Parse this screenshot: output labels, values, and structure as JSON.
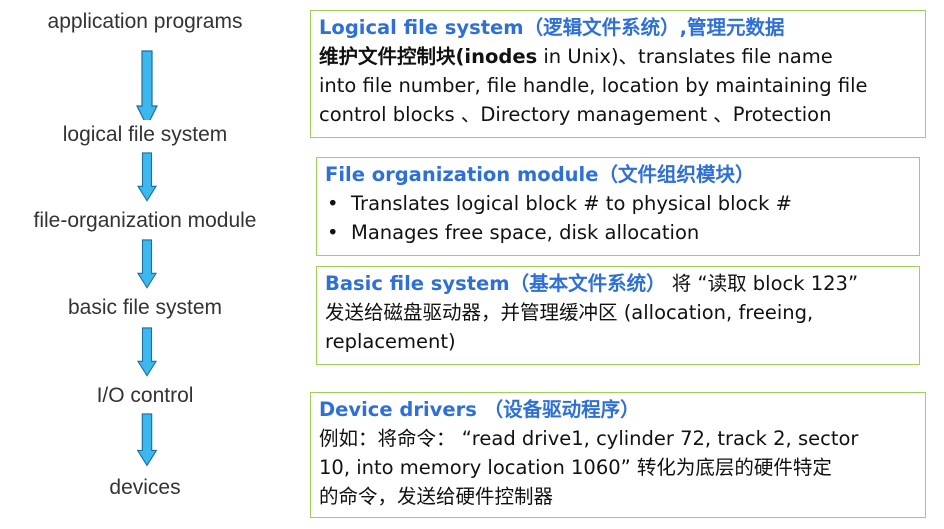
{
  "colors": {
    "accent": "#2e6fd8",
    "box_border": "#9fd15a",
    "arrow_fill": "#3db8ee",
    "arrow_stroke": "#1a6e9e"
  },
  "layers": [
    "application programs",
    "logical file system",
    "file-organization module",
    "basic file system",
    "I/O control",
    "devices"
  ],
  "boxes": {
    "logical": {
      "title": "Logical file system（逻辑文件系统）,管理元数据",
      "line1_pre": "维护文件控制块(",
      "line1_bold": "inodes",
      "line1_post": " in Unix)、translates file name",
      "line2": "into file number, file handle, location by maintaining file",
      "line3": "control blocks 、Directory management 、Protection"
    },
    "organization": {
      "title": "File organization module（文件组织模块）",
      "bullet_symbol": "•",
      "bullets": [
        "Translates logical block # to physical block #",
        "Manages free space, disk allocation"
      ]
    },
    "basic": {
      "title": "Basic file system（基本文件系统）",
      "line1_rest": " 将 “读取 block 123”",
      "line2": "发送给磁盘驱动器，并管理缓冲区 (allocation, freeing,",
      "line3": "replacement)"
    },
    "drivers": {
      "title": "Device drivers （设备驱动程序）",
      "line1": "例如：将命令： “read drive1, cylinder 72, track 2, sector",
      "line2": "10, into memory location 1060” 转化为底层的硬件特定",
      "line3": "的命令，发送给硬件控制器"
    }
  }
}
